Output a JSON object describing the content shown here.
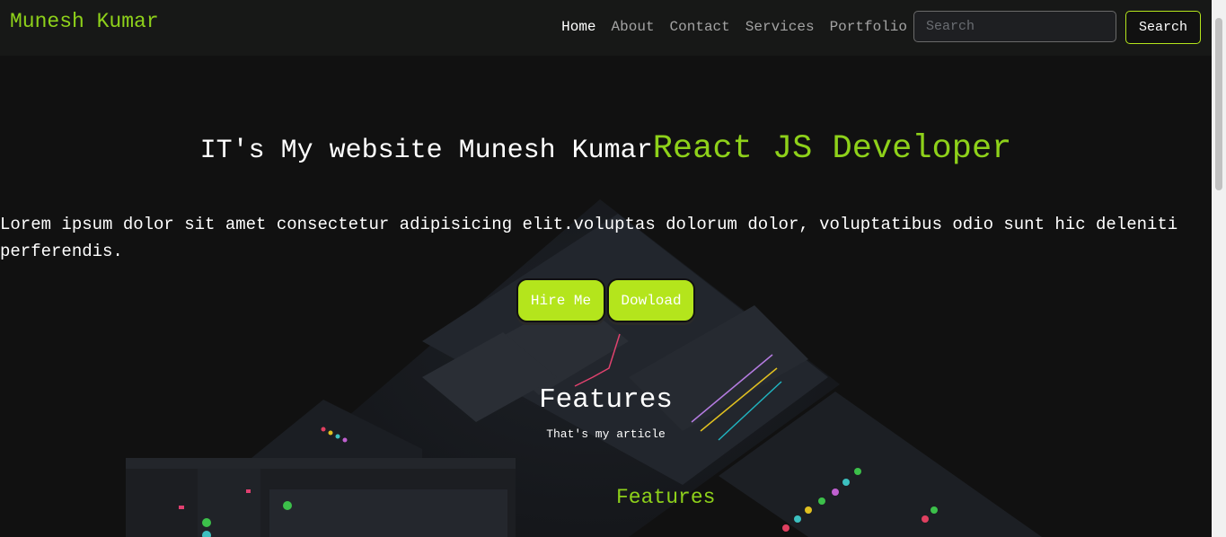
{
  "nav": {
    "brand": "Munesh Kumar",
    "links": [
      "Home",
      "About",
      "Contact",
      "Services",
      "Portfolio"
    ],
    "search_placeholder": "Search",
    "search_button": "Search"
  },
  "hero": {
    "title": "IT's My website Munesh Kumar",
    "title_accent": "React JS Developer",
    "text": "Lorem ipsum dolor sit amet consectetur adipisicing elit.voluptas dolorum dolor, voluptatibus odio sunt hic deleniti perferendis.",
    "hire_button": "Hire Me",
    "download_button": "Dowload"
  },
  "features": {
    "title": "Features",
    "subtitle": "That's my article",
    "title_2": "Features"
  },
  "colors": {
    "accent": "#8ed11a",
    "button": "#b4e51c",
    "background": "#111111",
    "navbar": "#171817"
  }
}
